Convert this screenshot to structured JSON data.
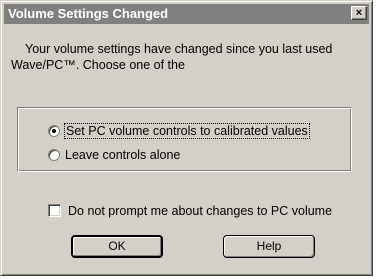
{
  "window": {
    "title": "Volume Settings Changed",
    "close_glyph": "×"
  },
  "message": {
    "line1": "Your volume settings have changed since you last used",
    "line2": "Wave/PC™. Choose one of the"
  },
  "options": {
    "selected": "set_calibrated",
    "items": [
      {
        "id": "set_calibrated",
        "label": "Set PC volume controls to calibrated values",
        "checked": true
      },
      {
        "id": "leave_alone",
        "label": "Leave controls alone",
        "checked": false
      }
    ]
  },
  "dont_prompt": {
    "label": "Do not prompt me about changes to PC volume",
    "checked": false
  },
  "buttons": {
    "ok": "OK",
    "help": "Help"
  },
  "colors": {
    "dialog_face": "#d4d0c8",
    "titlebar_inactive": "#808080",
    "title_text": "#ffffff"
  }
}
